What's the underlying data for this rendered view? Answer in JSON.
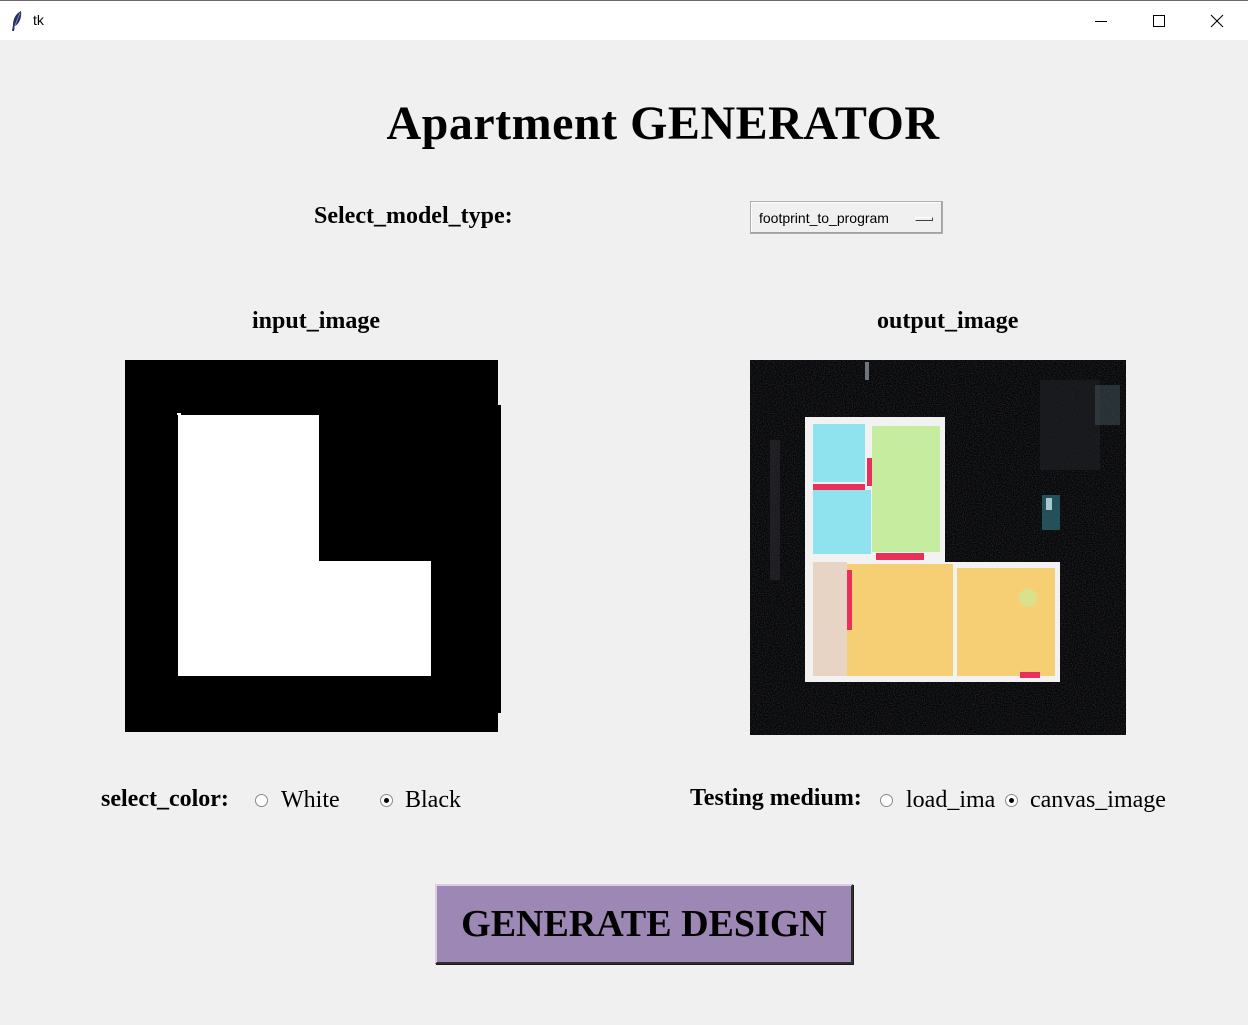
{
  "window": {
    "title": "tk"
  },
  "app": {
    "title": "Apartment GENERATOR",
    "model_label": "Select_model_type:",
    "model_value": "footprint_to_program",
    "input_label": "input_image",
    "output_label": "output_image",
    "color_label": "select_color:",
    "color_options": [
      {
        "label": "White",
        "checked": false
      },
      {
        "label": "Black",
        "checked": true
      }
    ],
    "medium_label": "Testing medium:",
    "medium_options": [
      {
        "label": "load_ima",
        "checked": false
      },
      {
        "label": "canvas_image",
        "checked": true
      }
    ],
    "generate_label": "GENERATE DESIGN"
  },
  "colors": {
    "background": "#f0f0f0",
    "generate_button": "#9d88b5",
    "room_green": "#c6ec9f",
    "room_cyan": "#8fe3ee",
    "room_orange": "#f6cf74",
    "room_red": "#e8305a"
  }
}
